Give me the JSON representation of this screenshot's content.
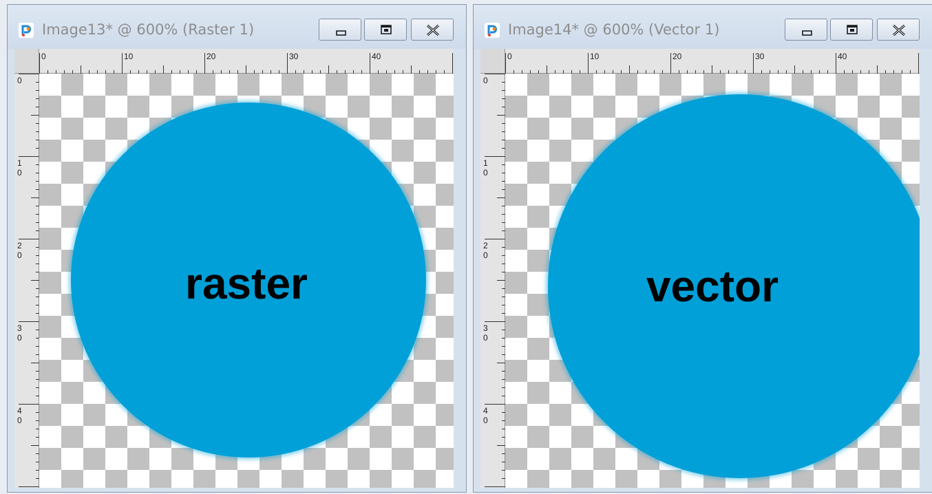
{
  "windows": [
    {
      "title": "Image13* @ 600% (Raster 1)",
      "canvas_text": "raster",
      "ruler_h_labels": [
        "0",
        "10",
        "20",
        "30",
        "40"
      ],
      "ruler_v_labels": [
        [
          "0"
        ],
        [
          "1",
          "0"
        ],
        [
          "2",
          "0"
        ],
        [
          "3",
          "0"
        ],
        [
          "4",
          "0"
        ]
      ]
    },
    {
      "title": "Image14* @ 600% (Vector 1)",
      "canvas_text": "vector",
      "ruler_h_labels": [
        "0",
        "10",
        "20",
        "30",
        "40"
      ],
      "ruler_v_labels": [
        [
          "0"
        ],
        [
          "1",
          "0"
        ],
        [
          "2",
          "0"
        ],
        [
          "3",
          "0"
        ],
        [
          "4",
          "0"
        ]
      ]
    }
  ],
  "colors": {
    "circle": "#02a0d8",
    "checker_dark": "#c1c1c1",
    "checker_light": "#ffffff",
    "title_bar": "#d6e1ee"
  },
  "icons": {
    "app": "paintshop-pro-icon",
    "minimize": "minimize-icon",
    "maximize": "maximize-icon",
    "close": "close-icon"
  }
}
